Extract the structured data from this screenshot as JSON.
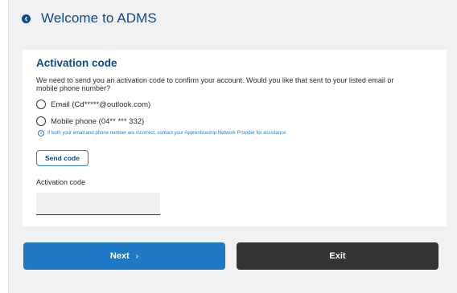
{
  "header": {
    "title": "Welcome to ADMS",
    "back_icon": "chevron-left-circle-icon"
  },
  "card": {
    "title": "Activation code",
    "description": "We need to send you an activation code to confirm your account. Would you like that sent to your listed email or mobile phone number?",
    "options": [
      {
        "label": "Email (Cd*****@outlook.com)",
        "selected": false
      },
      {
        "label": "Mobile phone (04** *** 332)",
        "selected": false
      }
    ],
    "info_text": "If both your email and phone number are incorrect, contact your Apprenticeship Network Provider for assistance.",
    "send_code_label": "Send code",
    "activation_code_label": "Activation code",
    "activation_code_value": ""
  },
  "footer": {
    "next_label": "Next",
    "next_chevron": "›",
    "exit_label": "Exit"
  },
  "colors": {
    "brand": "#0e4a8a",
    "primary_button": "#1f79c4",
    "exit_button": "#333333",
    "info": "#2b7bc4"
  }
}
